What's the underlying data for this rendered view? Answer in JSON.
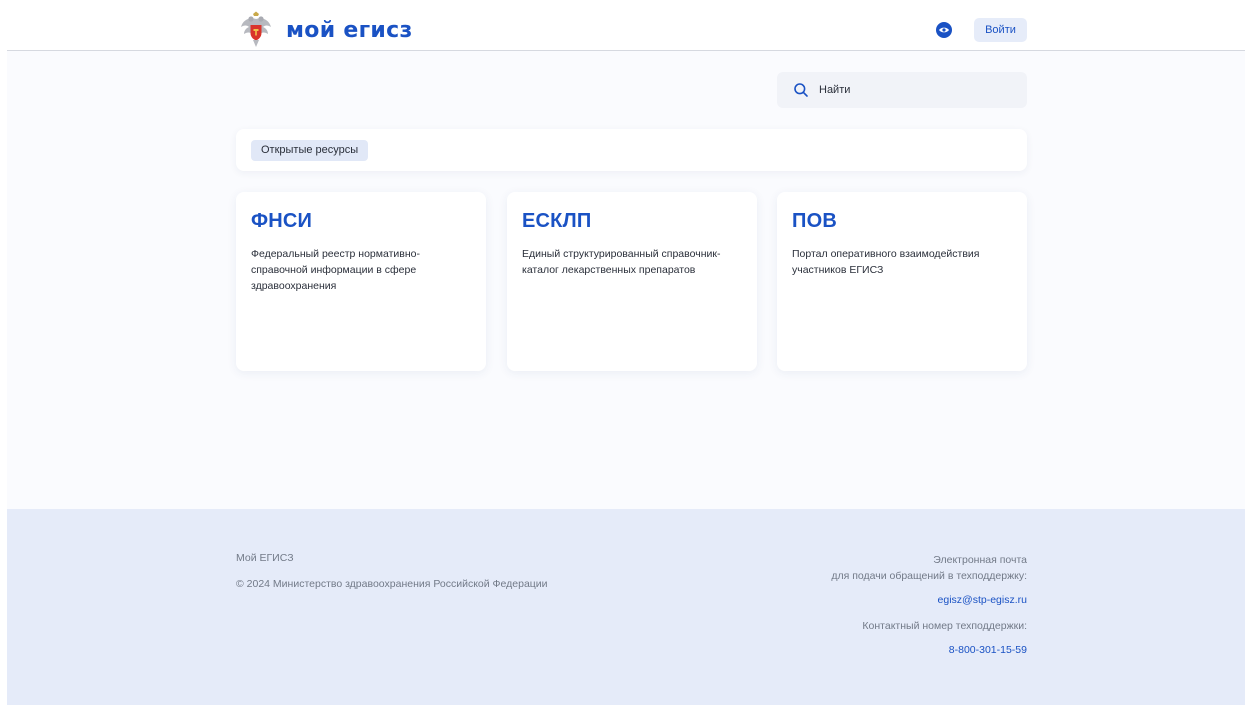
{
  "header": {
    "logo_text": "мой егисз",
    "login_label": "Войти",
    "icons": {
      "emblem": "coat-of-arms-icon",
      "accessibility": "eye-icon"
    }
  },
  "search": {
    "placeholder": "Найти",
    "icon": "search-icon"
  },
  "filters": {
    "chips": [
      "Открытые ресурсы"
    ]
  },
  "cards": [
    {
      "title": "ФНСИ",
      "description": "Федеральный реестр нормативно-справочной информации в сфере здравоохранения"
    },
    {
      "title": "ЕСКЛП",
      "description": "Единый структурированный справочник-каталог лекарственных препаратов"
    },
    {
      "title": "ПОВ",
      "description": "Портал оперативного взаимодействия участников ЕГИСЗ"
    }
  ],
  "footer": {
    "site_name": "Мой ЕГИСЗ",
    "copyright": "© 2024 Министерство здравоохранения Российской Федерации",
    "email_label_line1": "Электронная почта",
    "email_label_line2": "для подачи обращений в техподдержку:",
    "email": "egisz@stp-egisz.ru",
    "phone_label": "Контактный номер техподдержки:",
    "phone": "8-800-301-15-59"
  },
  "colors": {
    "brand": "#1a52c4",
    "chip_bg": "#e1e8f7",
    "footer_bg": "#e5ebf9",
    "main_bg": "#fafbfe"
  }
}
